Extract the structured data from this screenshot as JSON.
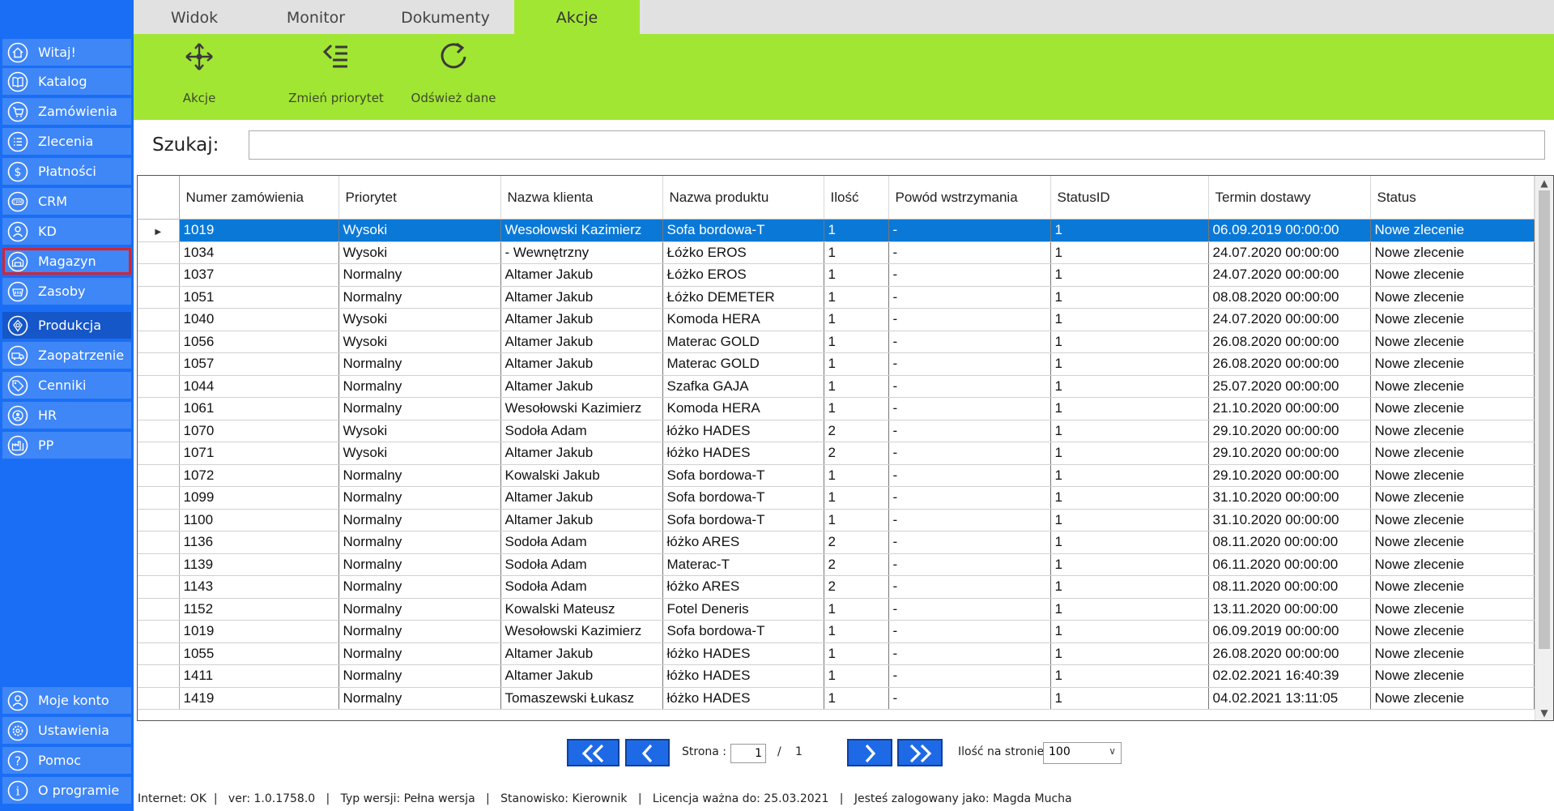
{
  "sidebar": {
    "items": [
      {
        "label": "Witaj!",
        "icon": "home-icon"
      },
      {
        "label": "Katalog",
        "icon": "book-icon"
      },
      {
        "label": "Zamówienia",
        "icon": "cart-icon"
      },
      {
        "label": "Zlecenia",
        "icon": "list-icon"
      },
      {
        "label": "Płatności",
        "icon": "dollar-icon"
      },
      {
        "label": "CRM",
        "icon": "crm-icon"
      },
      {
        "label": "KD",
        "icon": "user-icon"
      },
      {
        "label": "Magazyn",
        "icon": "warehouse-icon"
      },
      {
        "label": "Zasoby",
        "icon": "basket-icon"
      },
      {
        "label": "Produkcja",
        "icon": "production-icon"
      },
      {
        "label": "Zaopatrzenie",
        "icon": "truck-icon"
      },
      {
        "label": "Cenniki",
        "icon": "tag-icon"
      },
      {
        "label": "HR",
        "icon": "hr-icon"
      },
      {
        "label": "PP",
        "icon": "factory-icon"
      }
    ],
    "bottom_items": [
      {
        "label": "Moje konto",
        "icon": "account-icon"
      },
      {
        "label": "Ustawienia",
        "icon": "settings-icon"
      },
      {
        "label": "Pomoc",
        "icon": "help-icon"
      },
      {
        "label": "O programie",
        "icon": "info-icon"
      }
    ]
  },
  "tabs": [
    "Widok",
    "Monitor",
    "Dokumenty",
    "Akcje"
  ],
  "active_tab": "Akcje",
  "ribbon": {
    "buttons": [
      {
        "label": "Akcje",
        "icon": "move-icon"
      },
      {
        "label": "Zmień priorytet",
        "icon": "priority-icon"
      },
      {
        "label": "Odśwież dane",
        "icon": "refresh-icon"
      }
    ]
  },
  "search": {
    "label": "Szukaj:",
    "value": ""
  },
  "table": {
    "headers": [
      "Numer zamówienia",
      "Priorytet",
      "Nazwa klienta",
      "Nazwa produktu",
      "Ilość",
      "Powód wstrzymania",
      "StatusID",
      "Termin dostawy",
      "Status"
    ],
    "rows": [
      [
        "1019",
        "Wysoki",
        "Wesołowski Kazimierz",
        "Sofa bordowa-T",
        "1",
        "-",
        "1",
        "06.09.2019 00:00:00",
        "Nowe zlecenie"
      ],
      [
        "1034",
        "Wysoki",
        "- Wewnętrzny",
        "Łóżko EROS",
        "1",
        "-",
        "1",
        "24.07.2020 00:00:00",
        "Nowe zlecenie"
      ],
      [
        "1037",
        "Normalny",
        "Altamer Jakub",
        "Łóżko EROS",
        "1",
        "-",
        "1",
        "24.07.2020 00:00:00",
        "Nowe zlecenie"
      ],
      [
        "1051",
        "Normalny",
        "Altamer Jakub",
        "Łóżko DEMETER",
        "1",
        "-",
        "1",
        "08.08.2020 00:00:00",
        "Nowe zlecenie"
      ],
      [
        "1040",
        "Wysoki",
        "Altamer Jakub",
        "Komoda HERA",
        "1",
        "-",
        "1",
        "24.07.2020 00:00:00",
        "Nowe zlecenie"
      ],
      [
        "1056",
        "Wysoki",
        "Altamer Jakub",
        "Materac GOLD",
        "1",
        "-",
        "1",
        "26.08.2020 00:00:00",
        "Nowe zlecenie"
      ],
      [
        "1057",
        "Normalny",
        "Altamer Jakub",
        "Materac GOLD",
        "1",
        "-",
        "1",
        "26.08.2020 00:00:00",
        "Nowe zlecenie"
      ],
      [
        "1044",
        "Normalny",
        "Altamer Jakub",
        "Szafka GAJA",
        "1",
        "-",
        "1",
        "25.07.2020 00:00:00",
        "Nowe zlecenie"
      ],
      [
        "1061",
        "Normalny",
        "Wesołowski Kazimierz",
        "Komoda HERA",
        "1",
        "-",
        "1",
        "21.10.2020 00:00:00",
        "Nowe zlecenie"
      ],
      [
        "1070",
        "Wysoki",
        "Sodoła  Adam",
        "łóżko HADES",
        "2",
        "-",
        "1",
        "29.10.2020 00:00:00",
        "Nowe zlecenie"
      ],
      [
        "1071",
        "Wysoki",
        "Altamer Jakub",
        "łóżko HADES",
        "2",
        "-",
        "1",
        "29.10.2020 00:00:00",
        "Nowe zlecenie"
      ],
      [
        "1072",
        "Normalny",
        "Kowalski Jakub",
        "Sofa bordowa-T",
        "1",
        "-",
        "1",
        "29.10.2020 00:00:00",
        "Nowe zlecenie"
      ],
      [
        "1099",
        "Normalny",
        "Altamer Jakub",
        "Sofa bordowa-T",
        "1",
        "-",
        "1",
        "31.10.2020 00:00:00",
        "Nowe zlecenie"
      ],
      [
        "1100",
        "Normalny",
        "Altamer Jakub",
        "Sofa bordowa-T",
        "1",
        "-",
        "1",
        "31.10.2020 00:00:00",
        "Nowe zlecenie"
      ],
      [
        "1136",
        "Normalny",
        "Sodoła  Adam",
        "łóżko ARES",
        "2",
        "-",
        "1",
        "08.11.2020 00:00:00",
        "Nowe zlecenie"
      ],
      [
        "1139",
        "Normalny",
        "Sodoła  Adam",
        "Materac-T",
        "2",
        "-",
        "1",
        "06.11.2020 00:00:00",
        "Nowe zlecenie"
      ],
      [
        "1143",
        "Normalny",
        "Sodoła  Adam",
        "łóżko ARES",
        "2",
        "-",
        "1",
        "08.11.2020 00:00:00",
        "Nowe zlecenie"
      ],
      [
        "1152",
        "Normalny",
        "Kowalski Mateusz",
        "Fotel Deneris",
        "1",
        "-",
        "1",
        "13.11.2020 00:00:00",
        "Nowe zlecenie"
      ],
      [
        "1019",
        "Normalny",
        "Wesołowski Kazimierz",
        "Sofa bordowa-T",
        "1",
        "-",
        "1",
        "06.09.2019 00:00:00",
        "Nowe zlecenie"
      ],
      [
        "1055",
        "Normalny",
        "Altamer Jakub",
        "łóżko HADES",
        "1",
        "-",
        "1",
        "26.08.2020 00:00:00",
        "Nowe zlecenie"
      ],
      [
        "1411",
        "Normalny",
        "Altamer Jakub",
        "łóżko HADES",
        "1",
        "-",
        "1",
        "02.02.2021 16:40:39",
        "Nowe zlecenie"
      ],
      [
        "1419",
        "Normalny",
        "Tomaszewski Łukasz",
        "łóżko HADES",
        "1",
        "-",
        "1",
        "04.02.2021 13:11:05",
        "Nowe zlecenie"
      ]
    ],
    "selected_row": 0
  },
  "pager": {
    "page_label": "Strona :",
    "page_value": "1",
    "separator": "/",
    "total_pages": "1",
    "page_size_label": "Ilość na stronie:",
    "page_size": "100"
  },
  "status_bar": {
    "text": "Internet: OK  |   ver: 1.0.1758.0   |   Typ wersji: Pełna wersja   |   Stanowisko: Kierownik   |   Licencja ważna do: 25.03.2021   |   Jesteś zalogowany jako: Magda Mucha"
  },
  "colors": {
    "sidebar": "#1a6ef5",
    "ribbon": "#a2e634",
    "selection": "#0a78d7",
    "highlight_border": "#d9232e"
  }
}
